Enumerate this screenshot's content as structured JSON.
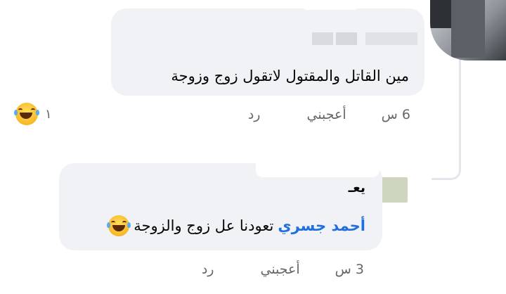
{
  "comments": [
    {
      "text": "مين القاتل والمقتول لاتقول زوج وزوجة",
      "time": "6 س",
      "like_label": "أعجبني",
      "reply_label": "رد",
      "reaction_count": "١",
      "reaction_icon": "laughing-tears-icon"
    }
  ],
  "reply": {
    "author": "يعـ",
    "mention": "أحمد جسري",
    "text": "تعودنا عل زوج والزوجة",
    "emoji_icon": "laughing-tears-icon",
    "time": "3 س",
    "like_label": "أعجبني",
    "reply_label": "رد"
  },
  "colors": {
    "bubble": "#f0f2f5",
    "mention": "#216fdb",
    "meta_text": "#65676b"
  }
}
